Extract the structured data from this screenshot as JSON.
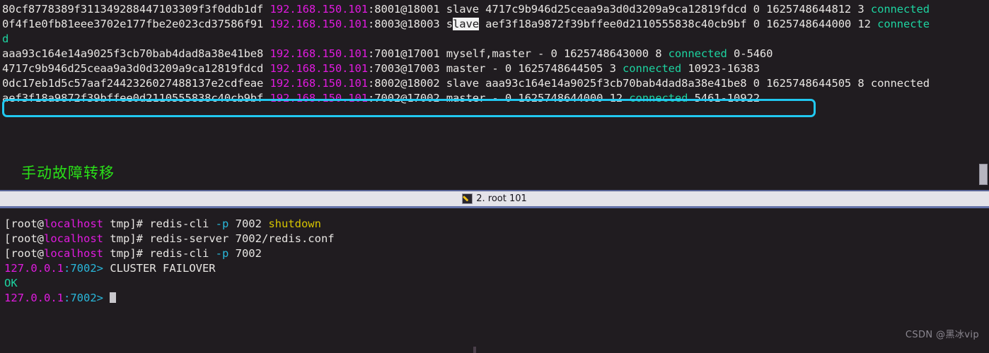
{
  "top_pane": {
    "lines": [
      [
        {
          "t": "80cf8778389f311349288447103309f3f0ddb1df ",
          "c": "white"
        },
        {
          "t": "192.168.150.101",
          "c": "magenta"
        },
        {
          "t": ":8001@18001 slave 4717c9b946d25ceaa9a3d0d3209a9ca12819fdcd 0 1625748644812 3 ",
          "c": "white"
        },
        {
          "t": "connected",
          "c": "green"
        }
      ],
      [
        {
          "t": "0f4f1e0fb81eee3702e177fbe2e023cd37586f91 ",
          "c": "white"
        },
        {
          "t": "192.168.150.101",
          "c": "magenta"
        },
        {
          "t": ":8003@18003 s",
          "c": "white"
        },
        {
          "t": "lave",
          "c": "sel"
        },
        {
          "t": " aef3f18a9872f39bffee0d2110555838c40cb9bf 0 1625748644000 12 ",
          "c": "white"
        },
        {
          "t": "connecte",
          "c": "green"
        }
      ],
      [
        {
          "t": "d",
          "c": "green"
        }
      ],
      [
        {
          "t": "aaa93c164e14a9025f3cb70bab4dad8a38e41be8 ",
          "c": "white"
        },
        {
          "t": "192.168.150.101",
          "c": "magenta"
        },
        {
          "t": ":7001@17001 myself,master - 0 1625748643000 8 ",
          "c": "white"
        },
        {
          "t": "connected",
          "c": "green"
        },
        {
          "t": " 0-5460",
          "c": "white"
        }
      ],
      [
        {
          "t": "4717c9b946d25ceaa9a3d0d3209a9ca12819fdcd ",
          "c": "white"
        },
        {
          "t": "192.168.150.101",
          "c": "magenta"
        },
        {
          "t": ":7003@17003 master - 0 1625748644505 3 ",
          "c": "white"
        },
        {
          "t": "connected",
          "c": "green"
        },
        {
          "t": " 10923-16383",
          "c": "white"
        }
      ],
      [
        {
          "t": "0dc17eb1d5c57aaf2442326027488137e2cdfeae ",
          "c": "white"
        },
        {
          "t": "192.168.150.101",
          "c": "magenta"
        },
        {
          "t": ":8002@18002 slave aaa93c164e14a9025f3cb70bab4dad8a38e41be8 0 1625748644505 8 connected",
          "c": "white"
        }
      ],
      [
        {
          "t": "aef3f18a9872f39bffee0d2110555838c40cb9bf ",
          "c": "white"
        },
        {
          "t": "192.168.150.101",
          "c": "magenta"
        },
        {
          "t": ":7002@17002 master - 0 1625748644000 12 ",
          "c": "white"
        },
        {
          "t": "connected",
          "c": "green"
        },
        {
          "t": " 5461-10922",
          "c": "white"
        }
      ]
    ]
  },
  "annotation": {
    "label": "手动故障转移",
    "box_color": "#21c8f0",
    "text_color": "#2ae018"
  },
  "statusbar": {
    "tab_label": "2. root 101",
    "tab_icon": "pencil-icon"
  },
  "bottom_pane": {
    "lines": [
      [
        {
          "t": "[root@",
          "c": "white"
        },
        {
          "t": "localhost",
          "c": "magenta"
        },
        {
          "t": " tmp]# redis-cli ",
          "c": "white"
        },
        {
          "t": "-p",
          "c": "cyan"
        },
        {
          "t": " 7002 ",
          "c": "white"
        },
        {
          "t": "shutdown",
          "c": "yellow"
        }
      ],
      [
        {
          "t": "[root@",
          "c": "white"
        },
        {
          "t": "localhost",
          "c": "magenta"
        },
        {
          "t": " tmp]# redis-server 7002/redis.conf",
          "c": "white"
        }
      ],
      [
        {
          "t": "[root@",
          "c": "white"
        },
        {
          "t": "localhost",
          "c": "magenta"
        },
        {
          "t": " tmp]# redis-cli ",
          "c": "white"
        },
        {
          "t": "-p",
          "c": "cyan"
        },
        {
          "t": " 7002",
          "c": "white"
        }
      ],
      [
        {
          "t": "127.0.0.1",
          "c": "magenta"
        },
        {
          "t": ":7002>",
          "c": "cyan"
        },
        {
          "t": " CLUSTER FAILOVER",
          "c": "white"
        }
      ],
      [
        {
          "t": "OK",
          "c": "green"
        }
      ],
      [
        {
          "t": "127.0.0.1",
          "c": "magenta"
        },
        {
          "t": ":7002>",
          "c": "cyan"
        },
        {
          "t": " ",
          "c": "white"
        },
        {
          "t": "",
          "c": "cursor"
        }
      ]
    ]
  },
  "watermark": {
    "text": "CSDN @黑冰vip"
  }
}
